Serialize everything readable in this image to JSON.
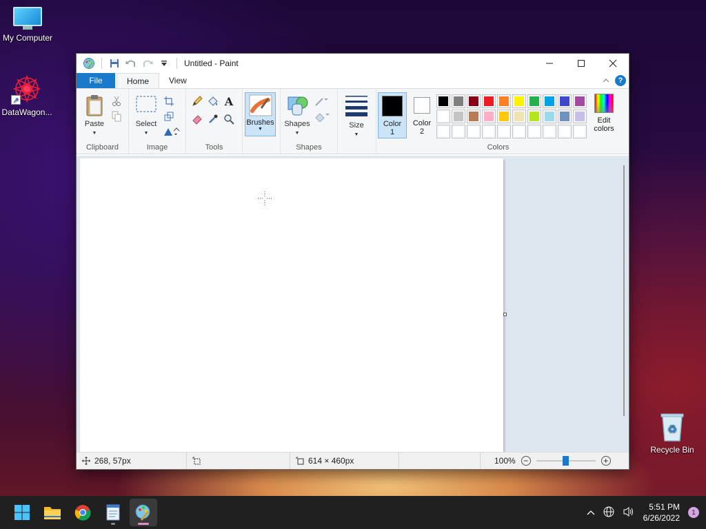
{
  "desktop": {
    "icons": [
      {
        "label": "My Computer",
        "icon": "monitor-icon"
      },
      {
        "label": "DataWagon...",
        "icon": "datawagon-icon"
      },
      {
        "label": "Recycle Bin",
        "icon": "recycle-bin-icon"
      }
    ]
  },
  "window": {
    "title": "Untitled - Paint",
    "tabs": {
      "file": "File",
      "home": "Home",
      "view": "View"
    }
  },
  "ribbon": {
    "clipboard": {
      "label": "Clipboard",
      "paste": "Paste"
    },
    "image": {
      "label": "Image",
      "select": "Select"
    },
    "tools": {
      "label": "Tools"
    },
    "brushes": {
      "label": "Brushes"
    },
    "shapes": {
      "label": "Shapes",
      "shapes_btn": "Shapes"
    },
    "size": {
      "label": "Size"
    },
    "colors": {
      "label": "Colors",
      "color1_a": "Color",
      "color1_b": "1",
      "color2_a": "Color",
      "color2_b": "2",
      "edit_a": "Edit",
      "edit_b": "colors",
      "color1_value": "#000000",
      "color2_value": "#ffffff",
      "palette_row1": [
        "#000000",
        "#7f7f7f",
        "#880015",
        "#ed1c24",
        "#ff7f27",
        "#fff200",
        "#22b14c",
        "#00a2e8",
        "#3f48cc",
        "#a349a4"
      ],
      "palette_row2": [
        "#ffffff",
        "#c3c3c3",
        "#b97a57",
        "#ffaec9",
        "#ffc90e",
        "#efe4b0",
        "#b5e61d",
        "#99d9ea",
        "#7092be",
        "#c8bfe7"
      ]
    }
  },
  "status": {
    "cursor_pos": "268, 57px",
    "canvas_size": "614 × 460px",
    "zoom": "100%",
    "zoom_fraction": 0.5
  },
  "taskbar": {
    "time": "5:51 PM",
    "date": "6/26/2022",
    "notifications": "1"
  }
}
